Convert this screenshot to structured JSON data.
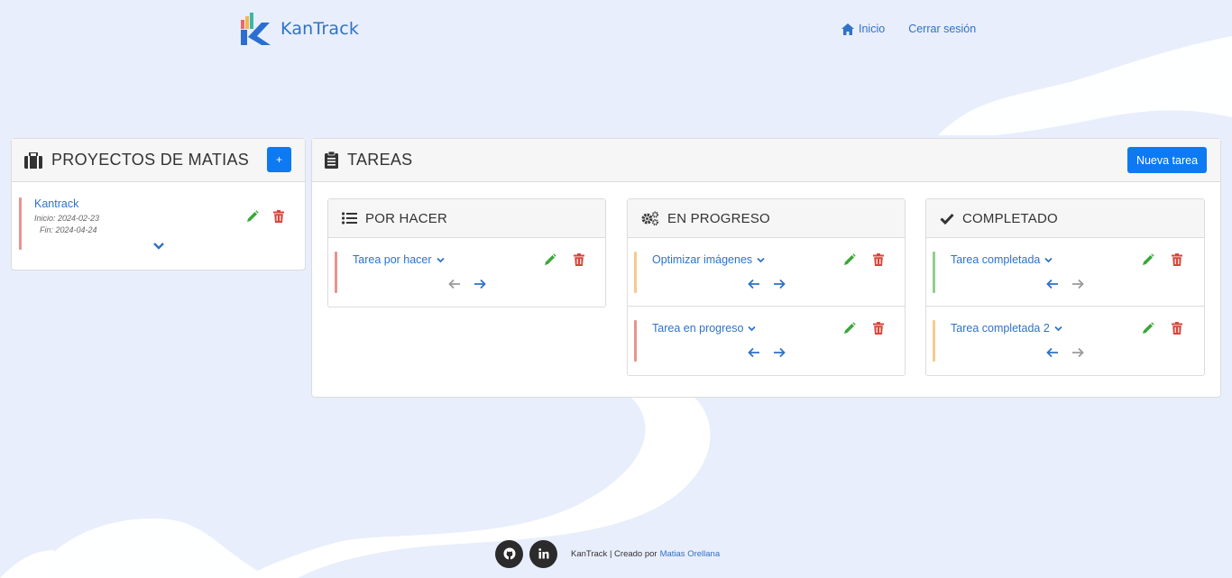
{
  "app": {
    "name": "KanTrack"
  },
  "nav": {
    "home": "Inicio",
    "logout": "Cerrar sesión"
  },
  "projects": {
    "title": "PROYECTOS DE MATIAS",
    "add_label": "+",
    "items": [
      {
        "name": "Kantrack",
        "start": "Inicio: 2024-02-23",
        "end": "Fin: 2024-04-24"
      }
    ]
  },
  "tasks": {
    "title": "TAREAS",
    "new_label": "Nueva tarea",
    "columns": [
      {
        "title": "POR HACER",
        "items": [
          {
            "name": "Tarea por hacer",
            "color": "#e6958f",
            "left_enabled": false,
            "right_enabled": true
          }
        ]
      },
      {
        "title": "EN PROGRESO",
        "items": [
          {
            "name": "Optimizar imágenes",
            "color": "#f5cc8d",
            "left_enabled": true,
            "right_enabled": true
          },
          {
            "name": "Tarea en progreso",
            "color": "#e6958f",
            "left_enabled": true,
            "right_enabled": true
          }
        ]
      },
      {
        "title": "COMPLETADO",
        "items": [
          {
            "name": "Tarea completada",
            "color": "#8fcf8f",
            "left_enabled": true,
            "right_enabled": false
          },
          {
            "name": "Tarea completada 2",
            "color": "#f5cc8d",
            "left_enabled": true,
            "right_enabled": false
          }
        ]
      }
    ]
  },
  "footer": {
    "text": "KanTrack | Creado por",
    "author": "Matias Orellana"
  },
  "colors": {
    "accent": "#2f72c7",
    "primary_button": "#0d7af2",
    "edit": "#3aa83a",
    "delete": "#d9443a",
    "disabled": "#9a9a9a"
  }
}
